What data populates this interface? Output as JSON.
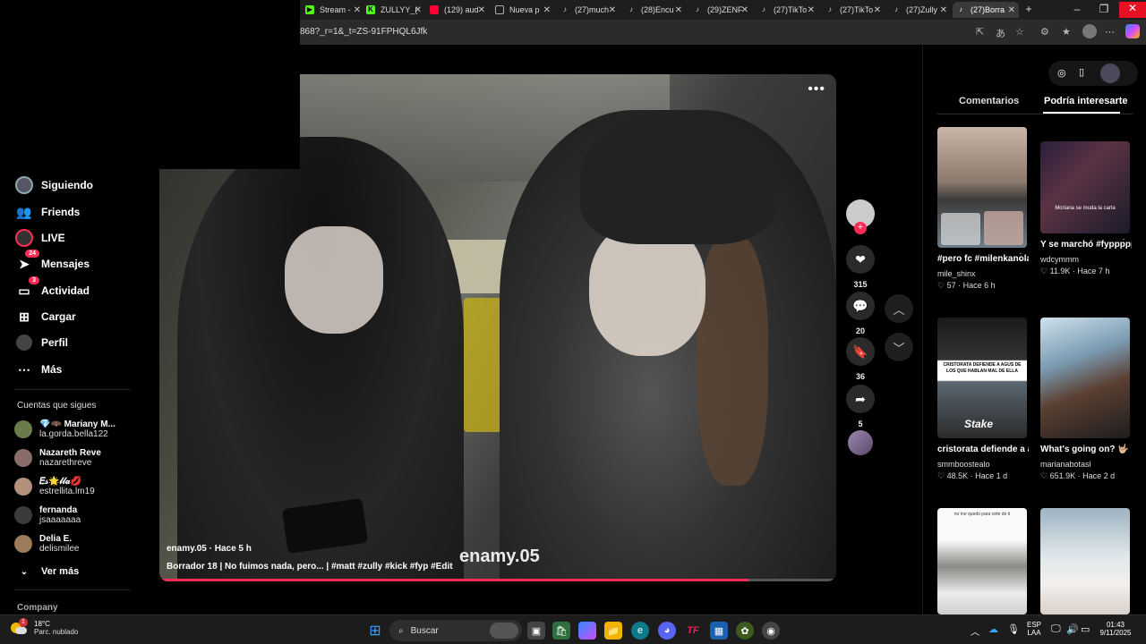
{
  "browser": {
    "tabs": [
      {
        "label": "Stream -",
        "color": "#53fc18"
      },
      {
        "label": "ZULLYY_(",
        "color": "#53fc18"
      },
      {
        "label": "(129) aud",
        "color": "#ff0033"
      },
      {
        "label": "Nueva p",
        "color": "#888888"
      },
      {
        "label": "(27)much",
        "color": "#ffffff"
      },
      {
        "label": "(28)Encu",
        "color": "#ffffff"
      },
      {
        "label": "(29)ZENF",
        "color": "#ffffff"
      },
      {
        "label": "(27)TikTo",
        "color": "#ffffff"
      },
      {
        "label": "(27)TikTo",
        "color": "#ffffff"
      },
      {
        "label": "(27)Zully",
        "color": "#ffffff"
      },
      {
        "label": "(27)Borra",
        "color": "#ffffff"
      }
    ],
    "url": "868?_r=1&_t=ZS-91FPHQL6Jfk"
  },
  "leftnav": {
    "items": [
      {
        "label": "Siguiendo",
        "icon": "following-avatar-icon",
        "badge": ""
      },
      {
        "label": "Friends",
        "icon": "friends-icon",
        "badge": ""
      },
      {
        "label": "LIVE",
        "icon": "live-icon",
        "badge": ""
      },
      {
        "label": "Mensajes",
        "icon": "messages-icon",
        "badge": "24"
      },
      {
        "label": "Actividad",
        "icon": "activity-icon",
        "badge": "3"
      },
      {
        "label": "Cargar",
        "icon": "upload-icon",
        "badge": ""
      },
      {
        "label": "Perfil",
        "icon": "profile-icon",
        "badge": ""
      },
      {
        "label": "Más",
        "icon": "more-icon",
        "badge": ""
      }
    ],
    "following_title": "Cuentas que sigues",
    "accounts": [
      {
        "name": "💎🦇 Mariany M...",
        "handle": "la.gorda.bella122"
      },
      {
        "name": "Nazareth Reve",
        "handle": "nazarethreve"
      },
      {
        "name": "𝐸𝓈🌟𝓁𝓁𝒶💋",
        "handle": "estrellita.lm19"
      },
      {
        "name": "fernanda",
        "handle": "jsaaaaaaa"
      },
      {
        "name": "Delia E.",
        "handle": "delismilee"
      }
    ],
    "see_more": "Ver más",
    "company": "Company"
  },
  "video": {
    "author_line": "enamy.05 · Hace 5 h",
    "description": "Borrador 18 | No fuimos nada, pero... | #matt  #zully  #kick  #fyp  #Edit",
    "watermark": "enamy.05",
    "progress": 0.87
  },
  "actions": {
    "likes": "315",
    "comments": "20",
    "saves": "36",
    "shares": "5"
  },
  "right": {
    "tabs": [
      "Comentarios",
      "Podría interesarte"
    ],
    "active_tab": 1,
    "cards": [
      {
        "title": "#pero fc #milenkanolasco...",
        "user": "mile_shinx",
        "meta": "♡ 57 · Hace 6 h"
      },
      {
        "title": "Y se marchó #fyppppppppp...",
        "user": "wdcymmm",
        "meta": "♡ 11.9K · Hace 7 h"
      },
      {
        "title": "cristorata defiende a agus...",
        "user": "smmboostealo",
        "meta": "♡ 48.5K · Hace 1 d"
      },
      {
        "title": "What's going on? 🤟🏼 @lalujans 💗",
        "user": "marianabotasl",
        "meta": "♡ 651.9K · Hace 2 d"
      },
      {
        "title": "",
        "user": "",
        "meta": ""
      },
      {
        "title": "",
        "user": "",
        "meta": ""
      }
    ],
    "thumb_texts": {
      "card2_caption": "Moriana se muda la carla",
      "card3_caption": "CRISTORATA DEFIENDE A AGUS DE LOS QUE HABLAN MAL DE ELLA",
      "card3_brand": "Stake",
      "card5_caption": "no me quedo para oirte de ti"
    }
  },
  "taskbar": {
    "temp": "18°C",
    "condition": "Parc. nublado",
    "search": "Buscar",
    "lang1": "ESP",
    "lang2": "LAA",
    "time": "01:43",
    "date": "9/11/2025",
    "weather_badge": "1"
  }
}
